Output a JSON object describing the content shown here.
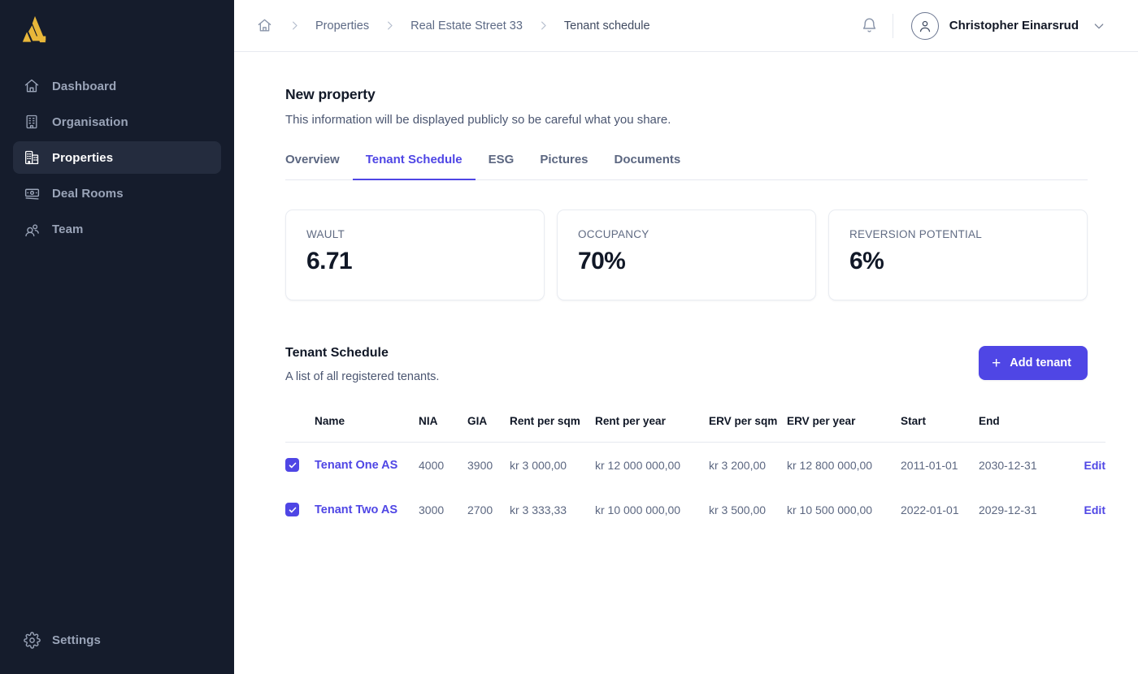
{
  "brand": {
    "logo_name": "company-logo",
    "logo_color": "#e8b73a"
  },
  "colors": {
    "accent": "#4f46e5",
    "sidebar_bg": "#151c2c",
    "sidebar_active_bg": "#242c3e"
  },
  "sidebar": {
    "items": [
      {
        "label": "Dashboard",
        "icon": "home-icon",
        "active": false
      },
      {
        "label": "Organisation",
        "icon": "building-icon",
        "active": false
      },
      {
        "label": "Properties",
        "icon": "buildings-icon",
        "active": true
      },
      {
        "label": "Deal Rooms",
        "icon": "banknote-icon",
        "active": false
      },
      {
        "label": "Team",
        "icon": "users-icon",
        "active": false
      }
    ],
    "bottom": {
      "label": "Settings",
      "icon": "gear-icon"
    }
  },
  "topbar": {
    "home_icon": "home-icon",
    "breadcrumbs": [
      "Properties",
      "Real Estate Street 33",
      "Tenant schedule"
    ],
    "notification_icon": "bell-icon",
    "user_name": "Christopher Einarsrud",
    "avatar_icon": "user-avatar-icon",
    "chevron_icon": "chevron-down-icon"
  },
  "page": {
    "title": "New property",
    "subtitle": "This information will be displayed publicly so be careful what you share.",
    "tabs": [
      {
        "label": "Overview",
        "active": false
      },
      {
        "label": "Tenant Schedule",
        "active": true
      },
      {
        "label": "ESG",
        "active": false
      },
      {
        "label": "Pictures",
        "active": false
      },
      {
        "label": "Documents",
        "active": false
      }
    ]
  },
  "stats": [
    {
      "label": "WAULT",
      "value": "6.71"
    },
    {
      "label": "OCCUPANCY",
      "value": "70%"
    },
    {
      "label": "REVERSION POTENTIAL",
      "value": "6%"
    }
  ],
  "table_section": {
    "title": "Tenant Schedule",
    "subtitle": "A list of all registered tenants.",
    "add_button": {
      "label": "Add tenant",
      "icon": "plus-icon"
    }
  },
  "table": {
    "headers": [
      "Name",
      "NIA",
      "GIA",
      "Rent per sqm",
      "Rent per year",
      "ERV per sqm",
      "ERV per year",
      "Start",
      "End"
    ],
    "action_label": "Edit",
    "rows": [
      {
        "selected": true,
        "name": "Tenant One AS",
        "nia": "4000",
        "gia": "3900",
        "rent_per_sqm": "kr 3 000,00",
        "rent_per_year": "kr 12 000 000,00",
        "erv_per_sqm": "kr 3 200,00",
        "erv_per_year": "kr 12 800 000,00",
        "start": "2011-01-01",
        "end": "2030-12-31",
        "action": "Edit"
      },
      {
        "selected": true,
        "name": "Tenant Two AS",
        "nia": "3000",
        "gia": "2700",
        "rent_per_sqm": "kr 3 333,33",
        "rent_per_year": "kr 10 000 000,00",
        "erv_per_sqm": "kr 3 500,00",
        "erv_per_year": "kr 10 500 000,00",
        "start": "2022-01-01",
        "end": "2029-12-31",
        "action": "Edit"
      }
    ]
  }
}
